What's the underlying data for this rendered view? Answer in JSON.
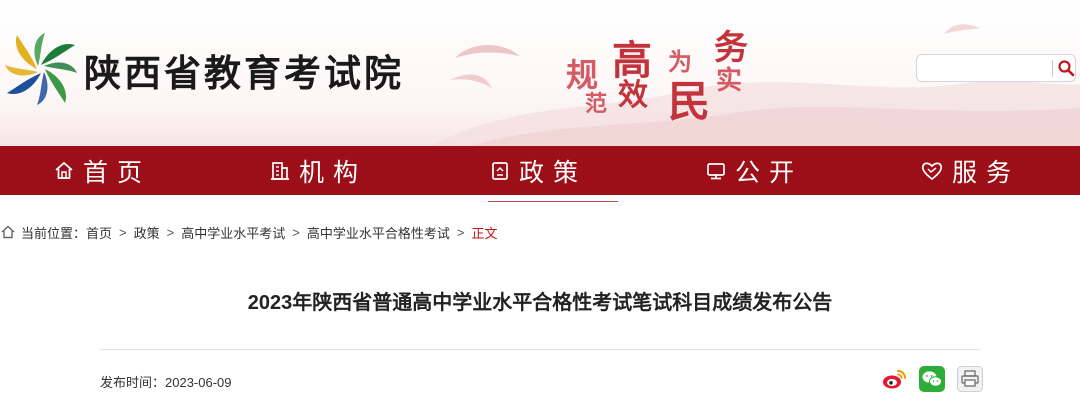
{
  "site": {
    "name": "陕西省教育考试院",
    "slogan": [
      "规",
      "范",
      "高",
      "效",
      "为",
      "民",
      "务",
      "实"
    ]
  },
  "search": {
    "value": "",
    "placeholder": ""
  },
  "nav": {
    "items": [
      {
        "label": "首页",
        "icon": "home-icon"
      },
      {
        "label": "机构",
        "icon": "building-icon"
      },
      {
        "label": "政策",
        "icon": "policy-document-icon"
      },
      {
        "label": "公开",
        "icon": "monitor-icon"
      },
      {
        "label": "服务",
        "icon": "heart-handshake-icon"
      }
    ],
    "active_index": 2
  },
  "breadcrumb": {
    "prefix": "当前位置：",
    "items": [
      "首页",
      "政策",
      "高中学业水平考试",
      "高中学业水平合格性考试"
    ],
    "current": "正文",
    "separator": ">"
  },
  "article": {
    "title": "2023年陕西省普通高中学业水平合格性考试笔试科目成绩发布公告",
    "publish_label": "发布时间：",
    "publish_date": "2023-06-09"
  },
  "share": {
    "icons": [
      "weibo-icon",
      "wechat-icon",
      "print-icon"
    ]
  },
  "colors": {
    "nav_bg": "#9c0f18",
    "accent_red": "#c0151c",
    "slogan_red": "#c2333b"
  }
}
